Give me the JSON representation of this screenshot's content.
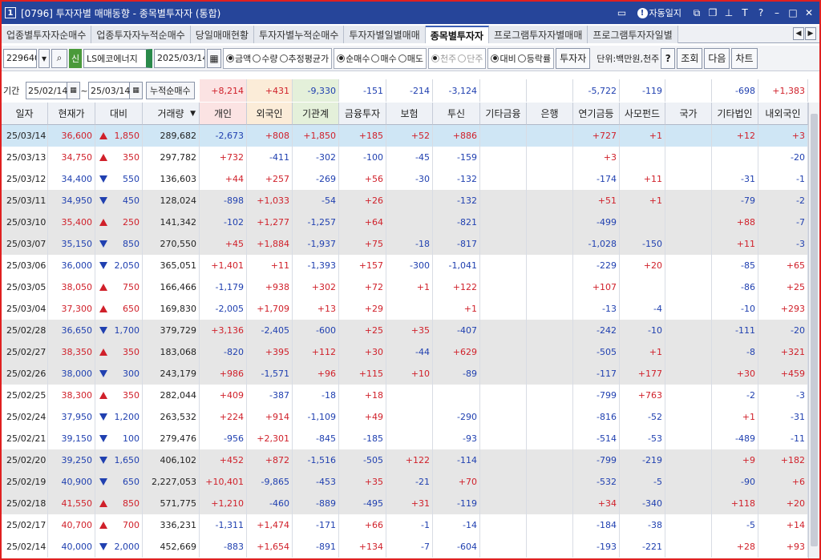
{
  "window": {
    "number": "1",
    "title": "[0796] 투자자별 매매동향 - 종목별투자자 (통합)",
    "autosave_label": "자동일지",
    "icons": [
      "screen-icon",
      "info-icon",
      "restore-icon",
      "copy-icon",
      "pin-icon",
      "font-icon",
      "help-icon",
      "minimize-icon",
      "maximize-icon",
      "close-icon"
    ]
  },
  "tabs": [
    {
      "label": "업종별투자자순매수",
      "active": false
    },
    {
      "label": "업종투자자누적순매수",
      "active": false
    },
    {
      "label": "당일매매현황",
      "active": false
    },
    {
      "label": "투자자별누적순매수",
      "active": false
    },
    {
      "label": "투자자별일별매매",
      "active": false
    },
    {
      "label": "종목별투자자",
      "active": true
    },
    {
      "label": "프로그램투자자별매매",
      "active": false
    },
    {
      "label": "프로그램투자자일별",
      "active": false
    }
  ],
  "toolbar": {
    "code": "229640",
    "market_tag": "신",
    "stock_name": "LS에코에너지",
    "date": "2025/03/14",
    "group1": [
      {
        "label": "금액",
        "on": true,
        "disabled": false
      },
      {
        "label": "수량",
        "on": false,
        "disabled": false
      },
      {
        "label": "추정평균가",
        "on": false,
        "disabled": false
      }
    ],
    "group2": [
      {
        "label": "순매수",
        "on": true,
        "disabled": false
      },
      {
        "label": "매수",
        "on": false,
        "disabled": false
      },
      {
        "label": "매도",
        "on": false,
        "disabled": false
      }
    ],
    "group3": [
      {
        "label": "천주",
        "on": true,
        "disabled": true
      },
      {
        "label": "단주",
        "on": false,
        "disabled": true
      }
    ],
    "group4": [
      {
        "label": "대비",
        "on": true,
        "disabled": false
      },
      {
        "label": "등락률",
        "on": false,
        "disabled": false
      }
    ],
    "investor_btn": "투자자",
    "unit_text": "단위:백만원,천주",
    "help_btn": "?",
    "query_btn": "조회",
    "next_btn": "다음",
    "chart_btn": "차트"
  },
  "period": {
    "label": "기간",
    "start": "25/02/14",
    "tilde": "~",
    "end": "25/03/14",
    "cumulative_label": "누적순매수"
  },
  "summary": {
    "individual": "+8,214",
    "foreign": "+431",
    "institution": "-9,330",
    "financial_invest": "-151",
    "insurance": "-214",
    "trust": "-3,124",
    "other_financial": "",
    "bank": "",
    "pension": "-5,722",
    "private_fund": "-119",
    "national": "",
    "other_corp": "-698",
    "domestic_foreign": "+1,383"
  },
  "columns": [
    "일자",
    "현재가",
    "대비",
    "거래량",
    "개인",
    "외국인",
    "기관계",
    "금융투자",
    "보험",
    "투신",
    "기타금융",
    "은행",
    "연기금등",
    "사모펀드",
    "국가",
    "기타법인",
    "내외국인"
  ],
  "rows": [
    {
      "date": "25/03/14",
      "price": "36,600",
      "dir": "up",
      "change": "1,850",
      "volume": "289,682",
      "ind": "-2,673",
      "frn": "+808",
      "inst": "+1,850",
      "fin": "+185",
      "ins": "+52",
      "trust": "+886",
      "etcf": "",
      "bank": "",
      "pens": "+727",
      "pf": "+1",
      "nat": "",
      "corp": "+12",
      "dom": "+3"
    },
    {
      "date": "25/03/13",
      "price": "34,750",
      "dir": "up",
      "change": "350",
      "volume": "297,782",
      "ind": "+732",
      "frn": "-411",
      "inst": "-302",
      "fin": "-100",
      "ins": "-45",
      "trust": "-159",
      "etcf": "",
      "bank": "",
      "pens": "+3",
      "pf": "",
      "nat": "",
      "corp": "",
      "dom": "-20"
    },
    {
      "date": "25/03/12",
      "price": "34,400",
      "dir": "down",
      "change": "550",
      "volume": "136,603",
      "ind": "+44",
      "frn": "+257",
      "inst": "-269",
      "fin": "+56",
      "ins": "-30",
      "trust": "-132",
      "etcf": "",
      "bank": "",
      "pens": "-174",
      "pf": "+11",
      "nat": "",
      "corp": "-31",
      "dom": "-1"
    },
    {
      "date": "25/03/11",
      "price": "34,950",
      "dir": "down",
      "change": "450",
      "volume": "128,024",
      "ind": "-898",
      "frn": "+1,033",
      "inst": "-54",
      "fin": "+26",
      "ins": "",
      "trust": "-132",
      "etcf": "",
      "bank": "",
      "pens": "+51",
      "pf": "+1",
      "nat": "",
      "corp": "-79",
      "dom": "-2"
    },
    {
      "date": "25/03/10",
      "price": "35,400",
      "dir": "up",
      "change": "250",
      "volume": "141,342",
      "ind": "-102",
      "frn": "+1,277",
      "inst": "-1,257",
      "fin": "+64",
      "ins": "",
      "trust": "-821",
      "etcf": "",
      "bank": "",
      "pens": "-499",
      "pf": "",
      "nat": "",
      "corp": "+88",
      "dom": "-7"
    },
    {
      "date": "25/03/07",
      "price": "35,150",
      "dir": "down",
      "change": "850",
      "volume": "270,550",
      "ind": "+45",
      "frn": "+1,884",
      "inst": "-1,937",
      "fin": "+75",
      "ins": "-18",
      "trust": "-817",
      "etcf": "",
      "bank": "",
      "pens": "-1,028",
      "pf": "-150",
      "nat": "",
      "corp": "+11",
      "dom": "-3"
    },
    {
      "date": "25/03/06",
      "price": "36,000",
      "dir": "down",
      "change": "2,050",
      "volume": "365,051",
      "ind": "+1,401",
      "frn": "+11",
      "inst": "-1,393",
      "fin": "+157",
      "ins": "-300",
      "trust": "-1,041",
      "etcf": "",
      "bank": "",
      "pens": "-229",
      "pf": "+20",
      "nat": "",
      "corp": "-85",
      "dom": "+65"
    },
    {
      "date": "25/03/05",
      "price": "38,050",
      "dir": "up",
      "change": "750",
      "volume": "166,466",
      "ind": "-1,179",
      "frn": "+938",
      "inst": "+302",
      "fin": "+72",
      "ins": "+1",
      "trust": "+122",
      "etcf": "",
      "bank": "",
      "pens": "+107",
      "pf": "",
      "nat": "",
      "corp": "-86",
      "dom": "+25"
    },
    {
      "date": "25/03/04",
      "price": "37,300",
      "dir": "up",
      "change": "650",
      "volume": "169,830",
      "ind": "-2,005",
      "frn": "+1,709",
      "inst": "+13",
      "fin": "+29",
      "ins": "",
      "trust": "+1",
      "etcf": "",
      "bank": "",
      "pens": "-13",
      "pf": "-4",
      "nat": "",
      "corp": "-10",
      "dom": "+293"
    },
    {
      "date": "25/02/28",
      "price": "36,650",
      "dir": "down",
      "change": "1,700",
      "volume": "379,729",
      "ind": "+3,136",
      "frn": "-2,405",
      "inst": "-600",
      "fin": "+25",
      "ins": "+35",
      "trust": "-407",
      "etcf": "",
      "bank": "",
      "pens": "-242",
      "pf": "-10",
      "nat": "",
      "corp": "-111",
      "dom": "-20"
    },
    {
      "date": "25/02/27",
      "price": "38,350",
      "dir": "up",
      "change": "350",
      "volume": "183,068",
      "ind": "-820",
      "frn": "+395",
      "inst": "+112",
      "fin": "+30",
      "ins": "-44",
      "trust": "+629",
      "etcf": "",
      "bank": "",
      "pens": "-505",
      "pf": "+1",
      "nat": "",
      "corp": "-8",
      "dom": "+321"
    },
    {
      "date": "25/02/26",
      "price": "38,000",
      "dir": "down",
      "change": "300",
      "volume": "243,179",
      "ind": "+986",
      "frn": "-1,571",
      "inst": "+96",
      "fin": "+115",
      "ins": "+10",
      "trust": "-89",
      "etcf": "",
      "bank": "",
      "pens": "-117",
      "pf": "+177",
      "nat": "",
      "corp": "+30",
      "dom": "+459"
    },
    {
      "date": "25/02/25",
      "price": "38,300",
      "dir": "up",
      "change": "350",
      "volume": "282,044",
      "ind": "+409",
      "frn": "-387",
      "inst": "-18",
      "fin": "+18",
      "ins": "",
      "trust": "",
      "etcf": "",
      "bank": "",
      "pens": "-799",
      "pf": "+763",
      "nat": "",
      "corp": "-2",
      "dom": "-3"
    },
    {
      "date": "25/02/24",
      "price": "37,950",
      "dir": "down",
      "change": "1,200",
      "volume": "263,532",
      "ind": "+224",
      "frn": "+914",
      "inst": "-1,109",
      "fin": "+49",
      "ins": "",
      "trust": "-290",
      "etcf": "",
      "bank": "",
      "pens": "-816",
      "pf": "-52",
      "nat": "",
      "corp": "+1",
      "dom": "-31"
    },
    {
      "date": "25/02/21",
      "price": "39,150",
      "dir": "down",
      "change": "100",
      "volume": "279,476",
      "ind": "-956",
      "frn": "+2,301",
      "inst": "-845",
      "fin": "-185",
      "ins": "",
      "trust": "-93",
      "etcf": "",
      "bank": "",
      "pens": "-514",
      "pf": "-53",
      "nat": "",
      "corp": "-489",
      "dom": "-11"
    },
    {
      "date": "25/02/20",
      "price": "39,250",
      "dir": "down",
      "change": "1,650",
      "volume": "406,102",
      "ind": "+452",
      "frn": "+872",
      "inst": "-1,516",
      "fin": "-505",
      "ins": "+122",
      "trust": "-114",
      "etcf": "",
      "bank": "",
      "pens": "-799",
      "pf": "-219",
      "nat": "",
      "corp": "+9",
      "dom": "+182"
    },
    {
      "date": "25/02/19",
      "price": "40,900",
      "dir": "down",
      "change": "650",
      "volume": "2,227,053",
      "ind": "+10,401",
      "frn": "-9,865",
      "inst": "-453",
      "fin": "+35",
      "ins": "-21",
      "trust": "+70",
      "etcf": "",
      "bank": "",
      "pens": "-532",
      "pf": "-5",
      "nat": "",
      "corp": "-90",
      "dom": "+6"
    },
    {
      "date": "25/02/18",
      "price": "41,550",
      "dir": "up",
      "change": "850",
      "volume": "571,775",
      "ind": "+1,210",
      "frn": "-460",
      "inst": "-889",
      "fin": "-495",
      "ins": "+31",
      "trust": "-119",
      "etcf": "",
      "bank": "",
      "pens": "+34",
      "pf": "-340",
      "nat": "",
      "corp": "+118",
      "dom": "+20"
    },
    {
      "date": "25/02/17",
      "price": "40,700",
      "dir": "up",
      "change": "700",
      "volume": "336,231",
      "ind": "-1,311",
      "frn": "+1,474",
      "inst": "-171",
      "fin": "+66",
      "ins": "-1",
      "trust": "-14",
      "etcf": "",
      "bank": "",
      "pens": "-184",
      "pf": "-38",
      "nat": "",
      "corp": "-5",
      "dom": "+14"
    },
    {
      "date": "25/02/14",
      "price": "40,000",
      "dir": "down",
      "change": "2,000",
      "volume": "452,669",
      "ind": "-883",
      "frn": "+1,654",
      "inst": "-891",
      "fin": "+134",
      "ins": "-7",
      "trust": "-604",
      "etcf": "",
      "bank": "",
      "pens": "-193",
      "pf": "-221",
      "nat": "",
      "corp": "+28",
      "dom": "+93"
    }
  ],
  "colors": {
    "up": "#d0202a",
    "down": "#2040b0",
    "selected_row": "#cfe6f5",
    "band": "#e6e6e6",
    "individual_header": "#fbe3e3",
    "foreign_header": "#fbecd8",
    "institution_header": "#e4f0da"
  }
}
